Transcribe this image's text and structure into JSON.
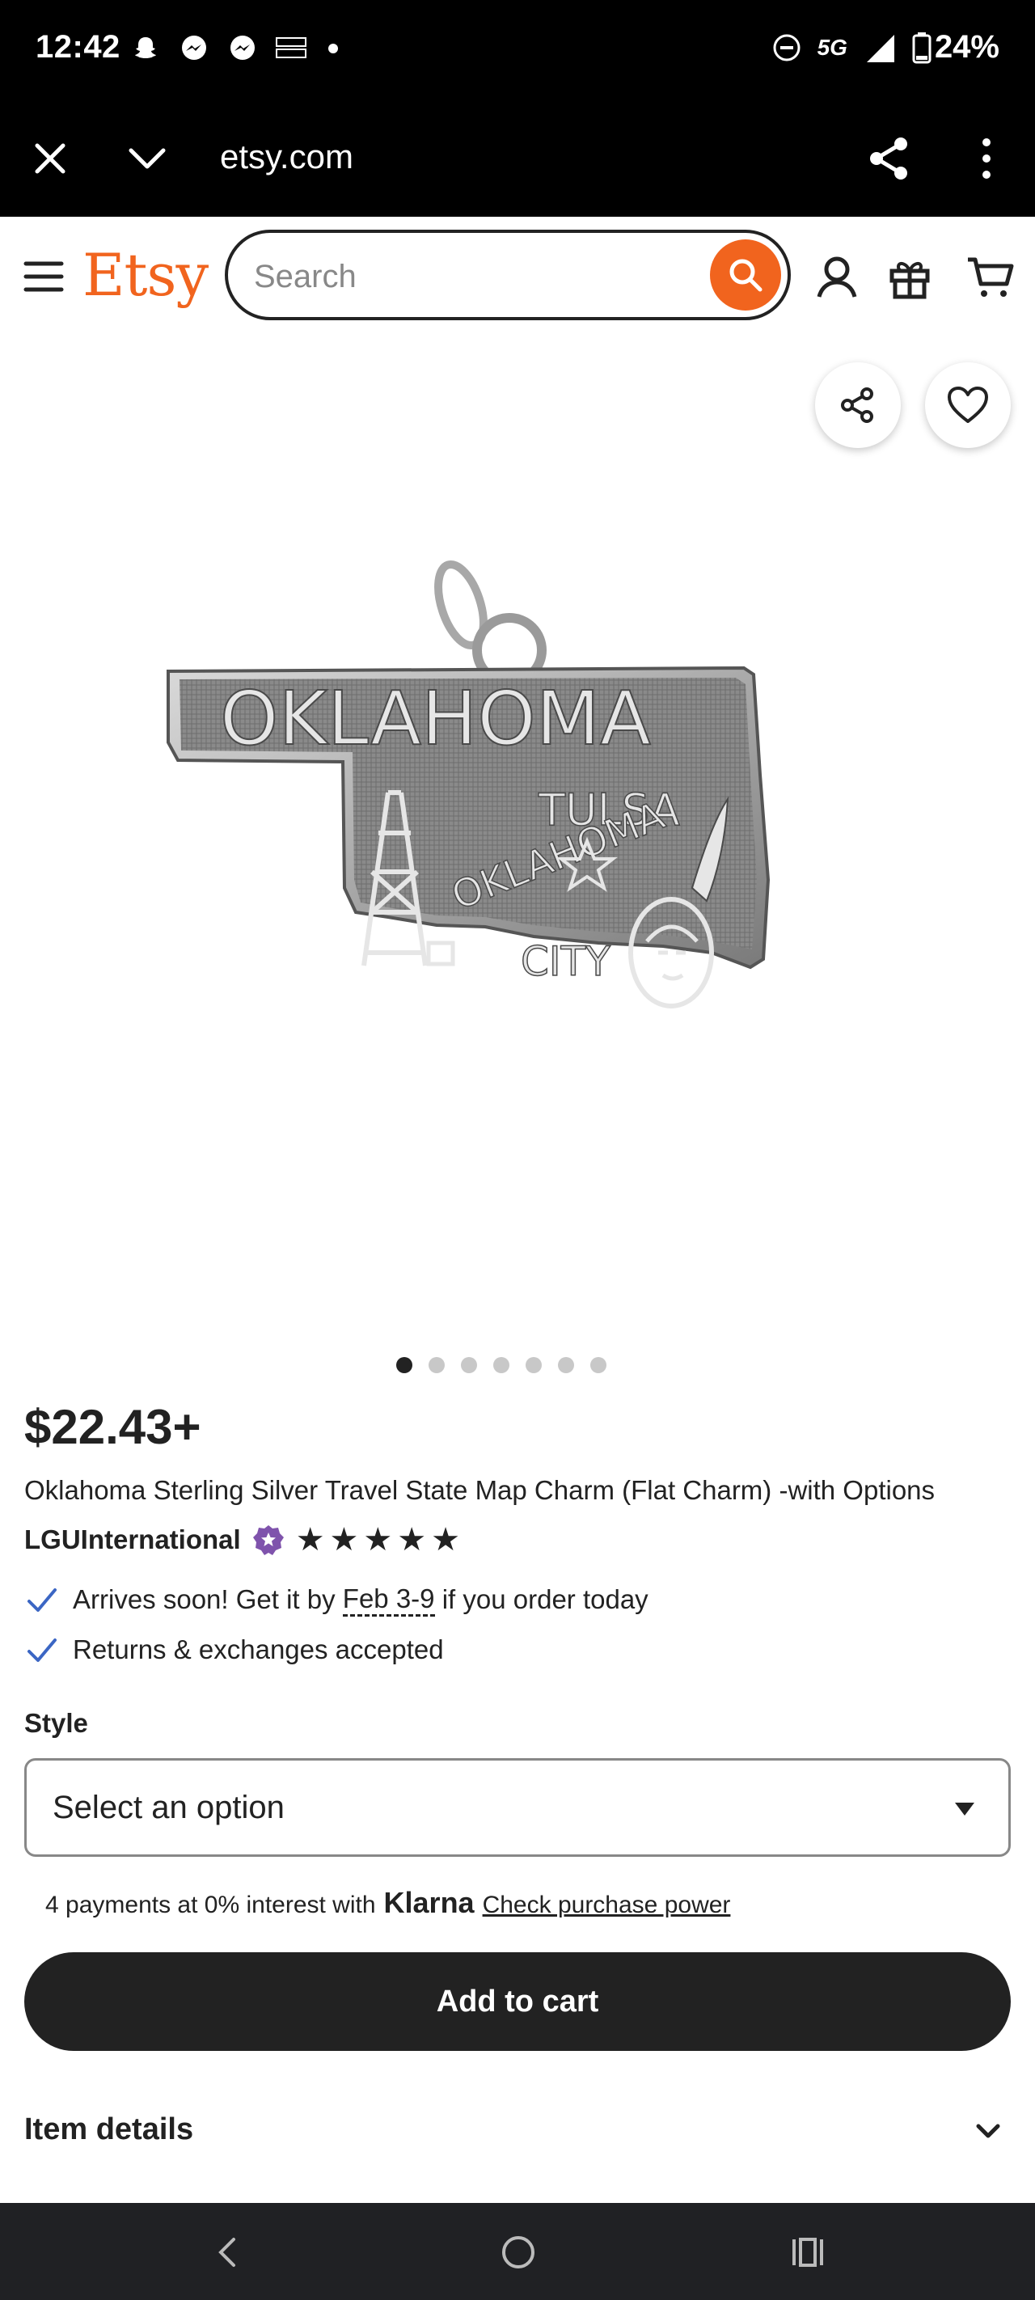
{
  "status_bar": {
    "time": "12:42",
    "network": "5G",
    "battery": "24%",
    "left_icons": [
      "snapchat-icon",
      "messenger-icon",
      "messenger-icon",
      "temu-icon"
    ],
    "right_icons": [
      "dnd-icon",
      "signal-icon",
      "battery-icon"
    ]
  },
  "browser": {
    "url": "etsy.com"
  },
  "header": {
    "logo": "Etsy",
    "search_placeholder": "Search",
    "accent_color": "#f1641e"
  },
  "product": {
    "image_alt": "Oklahoma state map charm",
    "charm_text": {
      "state": "OKLAHOMA",
      "city1": "TULSA",
      "city2": "OKLAHOMA",
      "city3": "CITY"
    },
    "carousel": {
      "total": 7,
      "active_index": 0
    },
    "price": "$22.43+",
    "title": "Oklahoma Sterling Silver Travel State Map Charm (Flat Charm) -with Options",
    "shop_name": "LGUInternational",
    "rating_stars": 5,
    "arrival": {
      "prefix": "Arrives soon! Get it by ",
      "dates": "Feb 3-9",
      "suffix": " if you order today"
    },
    "returns": "Returns & exchanges accepted"
  },
  "options": {
    "style_label": "Style",
    "style_selected": "Select an option"
  },
  "klarna": {
    "text": "4 payments at 0% interest with",
    "brand": "Klarna",
    "link": "Check purchase power"
  },
  "actions": {
    "add_to_cart": "Add to cart"
  },
  "details": {
    "label": "Item details"
  }
}
